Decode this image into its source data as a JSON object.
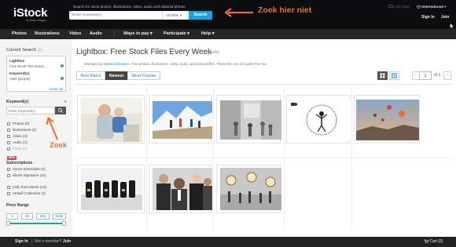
{
  "header": {
    "logo": "iStock",
    "logo_sub": "by Getty Images",
    "search_hint": "Search for stock photos, illustrations, video, audio and editorial photos",
    "search_placeholder": "Enter Keyword(s)",
    "search_scope": "All Files",
    "search_button": "Search",
    "annotation_top": "Zoek hier niet",
    "live_chat": "Live Chat",
    "international": "International",
    "sign_in": "Sign In",
    "join": "Join"
  },
  "nav": {
    "items": [
      "Photos",
      "Illustrations",
      "Video",
      "Audio",
      "Ways to pay",
      "Participate",
      "Help"
    ]
  },
  "sidebar": {
    "current_search_title": "Current Search",
    "current": [
      {
        "label": "Lightbox",
        "value": "Free Stock Files Every ..."
      },
      {
        "label": "Keyword(s)",
        "value": "AND (people)"
      }
    ],
    "clear_all": "Clear All",
    "keywords_title": "Keyword(s)",
    "keyword_placeholder": "Enter Keyword(s)",
    "annotation_side": "Zoek",
    "file_types": [
      {
        "label": "Photos",
        "count": "(8)"
      },
      {
        "label": "Illustrations",
        "count": "(4)"
      },
      {
        "label": "Video",
        "count": "(4)"
      },
      {
        "label": "Audio",
        "count": "(4)"
      },
      {
        "label": "Flash",
        "count": "(0)"
      }
    ],
    "new_badge": "NEW",
    "subscriptions_title": "Subscriptions",
    "subscriptions": [
      {
        "label": "iStock Essentials",
        "count": "(2)"
      },
      {
        "label": "iStock Signature",
        "count": "(11)"
      }
    ],
    "collections": [
      {
        "label": "Only from iStock",
        "count": "(16)"
      },
      {
        "label": "Vetta® Collection",
        "count": "(1)"
      }
    ],
    "price_title": "Price Range",
    "price_buttons": [
      "€",
      "€€",
      "€€€",
      "€€€€"
    ]
  },
  "main": {
    "title": "Lightbox: Free Stock Files Every Week",
    "count": "(8 results)",
    "managed_prefix": "Managed by ",
    "managed_link": "iStockCollections",
    "managed_suffix": ". Free photos, illustrations, video, audio and editorial files. These files are all royalty-free too.",
    "sort": [
      "Best Match",
      "Newest",
      "Most Popular"
    ],
    "sort_active": "Newest",
    "page": "1",
    "of_pages": "of 1",
    "tiles": [
      {
        "name": "thumb-father-child"
      },
      {
        "name": "thumb-mountain-hikers"
      },
      {
        "name": "thumb-street-crowd"
      },
      {
        "name": "thumb-pencil-sketch-video"
      },
      {
        "name": "thumb-hot-air-balloons"
      },
      {
        "name": "thumb-robot-figurines"
      },
      {
        "name": "thumb-business-people"
      },
      {
        "name": "thumb-clock-commuters"
      }
    ]
  },
  "footer": {
    "sign_in": "Sign In",
    "not_member": "Not a member?",
    "join": "Join",
    "cart": "Cart (0)"
  },
  "colors": {
    "accent_blue": "#1ea3d8",
    "annotation_orange": "#f26d21",
    "header_bg": "#0c0d0e",
    "nav_bg": "#262626",
    "price_teal": "#17a9a0"
  }
}
